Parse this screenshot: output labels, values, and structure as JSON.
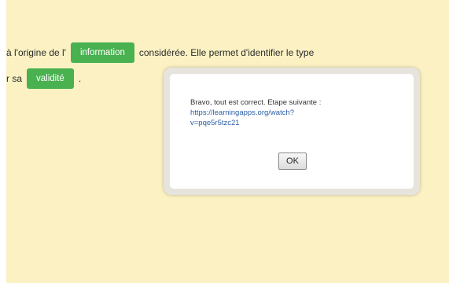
{
  "sentence": {
    "line1_prefix": "à l'origine de l'",
    "line1_tag": "information",
    "line1_suffix": "considérée. Elle permet d'identifier le type",
    "line2_prefix": "r sa",
    "line2_tag": "validité",
    "line2_suffix": "."
  },
  "dialog": {
    "message": "Bravo, tout est correct. Etape suivante :",
    "link_line1": "https://learningapps.org/watch?",
    "link_line2": "v=pqe5r5tzc21",
    "ok_label": "OK"
  },
  "colors": {
    "background": "#fbf1c3",
    "tag_green": "#49b14f",
    "link_blue": "#2b5fa8"
  }
}
